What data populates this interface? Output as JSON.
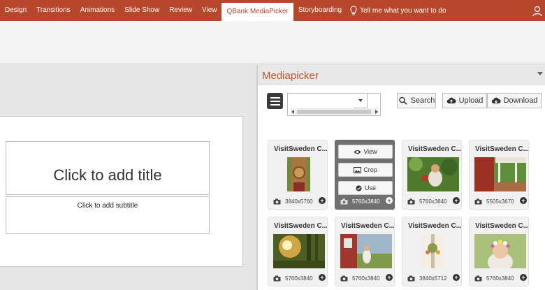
{
  "ribbon": {
    "tabs": [
      {
        "label": "Design"
      },
      {
        "label": "Transitions"
      },
      {
        "label": "Animations"
      },
      {
        "label": "Slide Show"
      },
      {
        "label": "Review"
      },
      {
        "label": "View"
      },
      {
        "label": "QBank MediaPicker",
        "active": true
      },
      {
        "label": "Storyboarding"
      }
    ],
    "tell_me": "Tell me what you want to do"
  },
  "slide": {
    "title_placeholder": "Click to add title",
    "subtitle_placeholder": "Click to add subtitle"
  },
  "panel": {
    "title": "Mediapicker",
    "search_value": "",
    "search_label": "Search",
    "upload_label": "Upload",
    "download_label": "Download",
    "overlay": {
      "view": "View",
      "crop": "Crop",
      "use": "Use"
    },
    "cards": [
      {
        "title": "VisitSweden C...",
        "dims": "3840x5760",
        "thumb": "portrait-basket"
      },
      {
        "title": "VisitSweden C...",
        "dims": "5760x3840",
        "thumb": "portrait-woman-hat"
      },
      {
        "title": "VisitSweden C...",
        "dims": "5760x3840",
        "thumb": "child-in-garden"
      },
      {
        "title": "VisitSweden C...",
        "dims": "5505x3670",
        "thumb": "red-house-porch"
      },
      {
        "title": "VisitSweden C...",
        "dims": "5760x3840",
        "thumb": "sunlit-forest"
      },
      {
        "title": "VisitSweden C...",
        "dims": "5760x3840",
        "thumb": "red-barn-dress"
      },
      {
        "title": "VisitSweden C...",
        "dims": "3840x5712",
        "thumb": "maypole-detail"
      },
      {
        "title": "VisitSweden C...",
        "dims": "5760x3840",
        "thumb": "girl-flower-crown"
      }
    ]
  },
  "colors": {
    "brand": "#b7472a",
    "panel_title": "#c0532f"
  }
}
